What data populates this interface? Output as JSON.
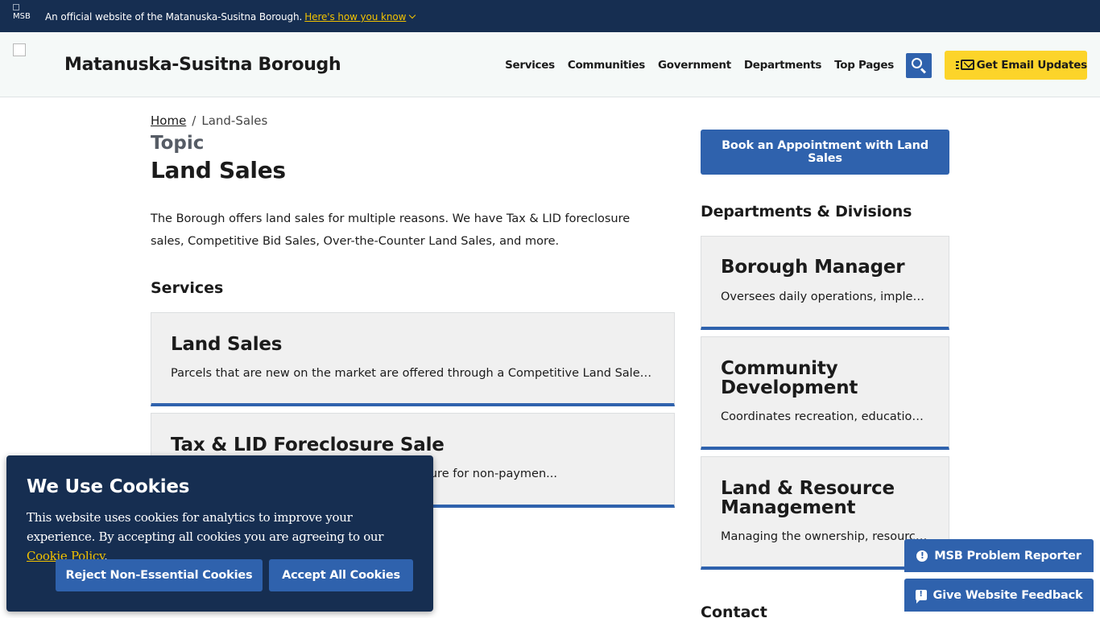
{
  "banner": {
    "flag_label": "MSB",
    "text": "An official website of the Matanuska-Susitna Borough.",
    "link": "Here's how you know"
  },
  "header": {
    "site_title": "Matanuska-Susitna Borough",
    "nav": [
      "Services",
      "Communities",
      "Government",
      "Departments",
      "Top Pages"
    ],
    "email_button": "Get Email Updates"
  },
  "breadcrumb": {
    "home": "Home",
    "separator": "/",
    "current": "Land-Sales"
  },
  "page": {
    "eyebrow": "Topic",
    "title": "Land Sales",
    "intro": "The Borough offers land sales for multiple reasons. We have Tax & LID foreclosure sales, Competitive Bid Sales, Over-the-Counter Land Sales, and more."
  },
  "services": {
    "heading": "Services",
    "items": [
      {
        "title": "Land Sales",
        "desc": "Parcels that are new on the market are offered through a Competitive Land Sale. Pa..."
      },
      {
        "title": "Tax & LID Foreclosure Sale",
        "desc": "The Borough acquires ownership by foreclosure for non-paymen..."
      }
    ]
  },
  "sidebar": {
    "book_button": "Book an Appointment with Land Sales",
    "dept_heading": "Departments & Divisions",
    "departments": [
      {
        "title": "Borough Manager",
        "desc": "Oversees daily operations, implem..."
      },
      {
        "title": "Community Development",
        "desc": "Coordinates recreation, education, ..."
      },
      {
        "title": "Land & Resource Management",
        "desc": "Managing the ownership, resource..."
      }
    ],
    "contact_heading": "Contact"
  },
  "floating": {
    "problem_reporter": "MSB Problem Reporter",
    "feedback": "Give Website Feedback"
  },
  "cookie": {
    "title": "We Use Cookies",
    "text": "This website uses cookies for analytics to improve your experience. By accepting all cookies you are agreeing to our",
    "link": "Cookie Policy",
    "period": ".",
    "reject": "Reject Non-Essential Cookies",
    "accept": "Accept All Cookies"
  },
  "colors": {
    "navy": "#162e51",
    "primary_blue": "#2f62ad",
    "yellow": "#fcd42a",
    "link_yellow": "#f2c200"
  }
}
